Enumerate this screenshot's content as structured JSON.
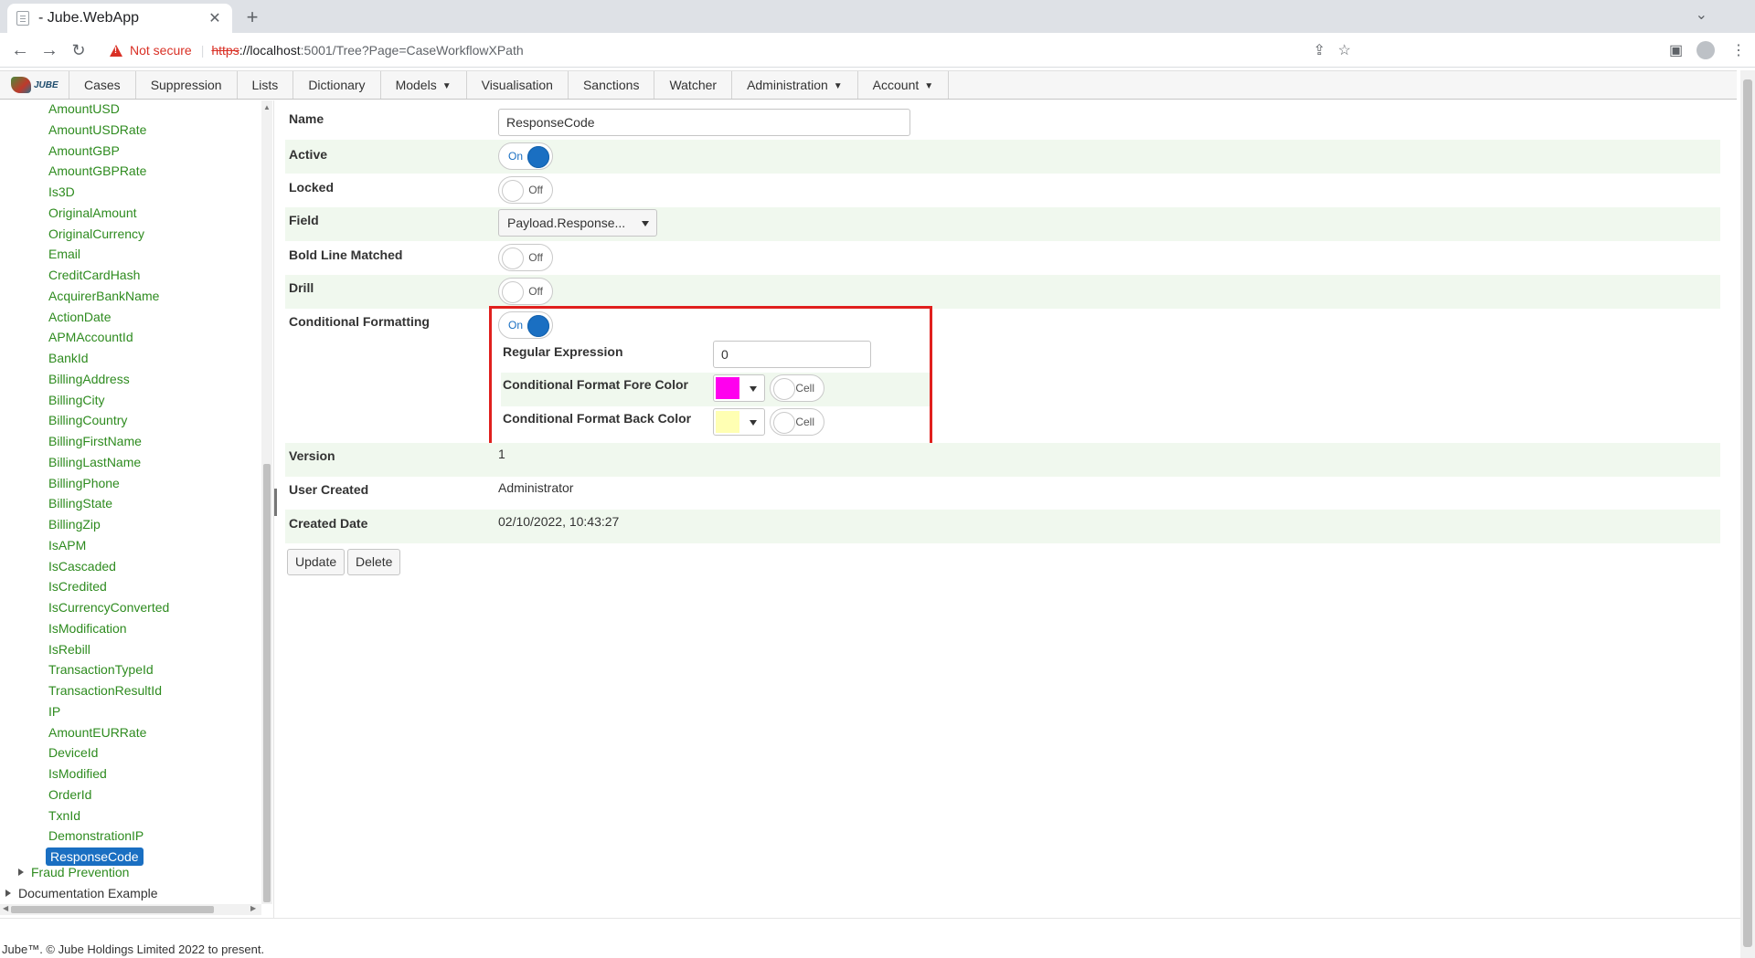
{
  "browser": {
    "tab_title": "- Jube.WebApp",
    "not_secure": "Not secure",
    "url_scheme": "https",
    "url_host": "://localhost",
    "url_path": ":5001/Tree?Page=CaseWorkflowXPath"
  },
  "menu": {
    "logo_text": "JUBE",
    "items": [
      {
        "label": "Cases"
      },
      {
        "label": "Suppression"
      },
      {
        "label": "Lists"
      },
      {
        "label": "Dictionary"
      },
      {
        "label": "Models",
        "dropdown": true
      },
      {
        "label": "Visualisation"
      },
      {
        "label": "Sanctions"
      },
      {
        "label": "Watcher"
      },
      {
        "label": "Administration",
        "dropdown": true
      },
      {
        "label": "Account",
        "dropdown": true
      }
    ]
  },
  "tree": {
    "items": [
      "AmountUSD",
      "AmountUSDRate",
      "AmountGBP",
      "AmountGBPRate",
      "Is3D",
      "OriginalAmount",
      "OriginalCurrency",
      "Email",
      "CreditCardHash",
      "AcquirerBankName",
      "ActionDate",
      "APMAccountId",
      "BankId",
      "BillingAddress",
      "BillingCity",
      "BillingCountry",
      "BillingFirstName",
      "BillingLastName",
      "BillingPhone",
      "BillingState",
      "BillingZip",
      "IsAPM",
      "IsCascaded",
      "IsCredited",
      "IsCurrencyConverted",
      "IsModification",
      "IsRebill",
      "TransactionTypeId",
      "TransactionResultId",
      "IP",
      "AmountEURRate",
      "DeviceId",
      "IsModified",
      "OrderId",
      "TxnId",
      "DemonstrationIP",
      "ResponseCode"
    ],
    "selected": "ResponseCode",
    "roots": [
      {
        "label": "Fraud Prevention"
      },
      {
        "label": "Documentation Example"
      }
    ]
  },
  "form": {
    "name_label": "Name",
    "name_value": "ResponseCode",
    "active_label": "Active",
    "active_state": "On",
    "locked_label": "Locked",
    "locked_state": "Off",
    "field_label": "Field",
    "field_value": "Payload.Response...",
    "bold_label": "Bold Line Matched",
    "bold_state": "Off",
    "drill_label": "Drill",
    "drill_state": "Off",
    "cf_label": "Conditional Formatting",
    "cf_state": "On",
    "regex_label": "Regular Expression",
    "regex_value": "0",
    "fore_label": "Conditional Format Fore Color",
    "fore_color": "#ff00ee",
    "fore_cell": "Cell",
    "back_label": "Conditional Format Back Color",
    "back_color": "#ffffb3",
    "back_cell": "Cell",
    "version_label": "Version",
    "version_value": "1",
    "user_label": "User Created",
    "user_value": "Administrator",
    "date_label": "Created Date",
    "date_value": "02/10/2022, 10:43:27",
    "update_button": "Update",
    "delete_button": "Delete"
  },
  "footer": {
    "text": "Jube™. © Jube Holdings Limited 2022 to present."
  }
}
